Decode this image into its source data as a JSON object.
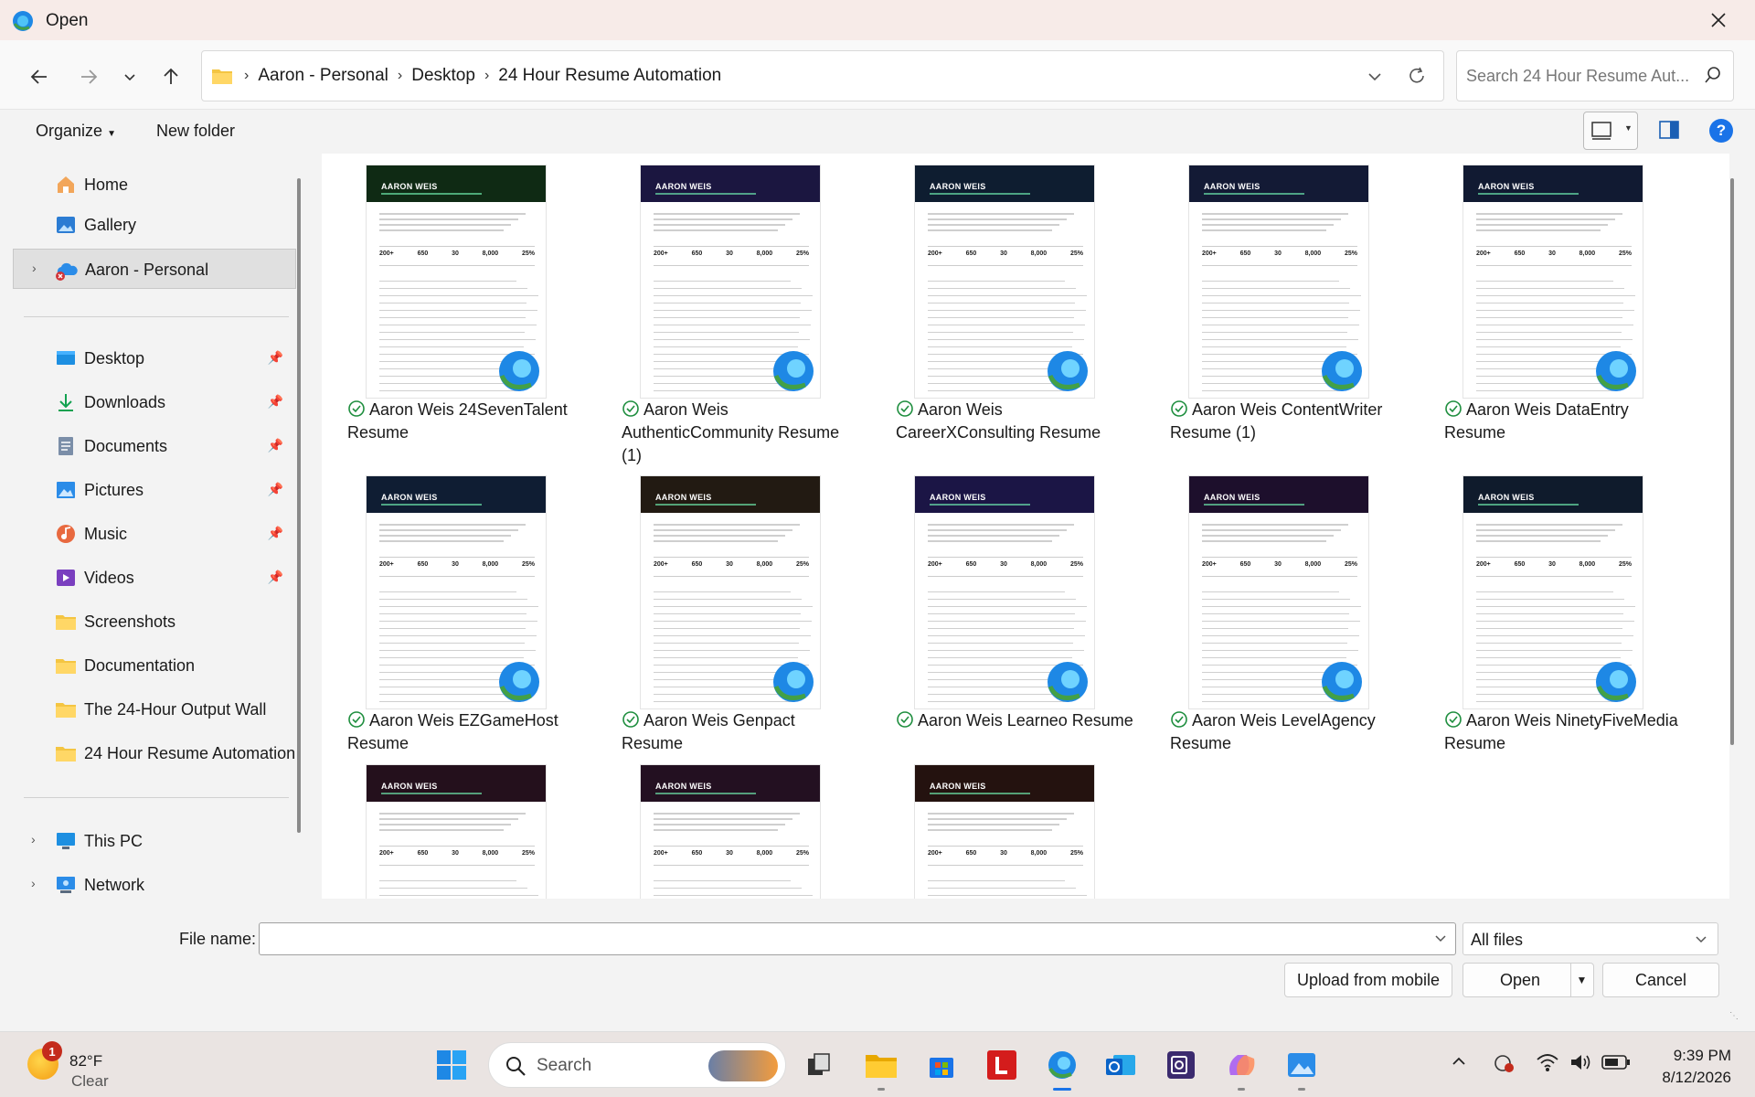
{
  "window": {
    "title": "Open"
  },
  "address": {
    "crumbs": [
      "Aaron - Personal",
      "Desktop",
      "24 Hour Resume Automation"
    ],
    "search_placeholder": "Search 24 Hour Resume Aut..."
  },
  "commands": {
    "organize": "Organize",
    "new_folder": "New folder"
  },
  "nav": {
    "home": "Home",
    "gallery": "Gallery",
    "onedrive": "Aaron - Personal",
    "desktop": "Desktop",
    "downloads": "Downloads",
    "documents": "Documents",
    "pictures": "Pictures",
    "music": "Music",
    "videos": "Videos",
    "screenshots": "Screenshots",
    "documentation": "Documentation",
    "output_wall": "The 24-Hour Output Wall",
    "resume_automation": "24 Hour Resume Automation",
    "this_pc": "This PC",
    "network": "Network"
  },
  "files": [
    {
      "name": "Aaron Weis 24SevenTalent Resume",
      "color": "#0f2a14"
    },
    {
      "name": "Aaron Weis AuthenticCommunity Resume (1)",
      "color": "#1b1640"
    },
    {
      "name": "Aaron Weis CareerXConsulting Resume",
      "color": "#0e1d30"
    },
    {
      "name": "Aaron Weis ContentWriter Resume (1)",
      "color": "#131a35"
    },
    {
      "name": "Aaron Weis DataEntry Resume",
      "color": "#111a32"
    },
    {
      "name": "Aaron Weis EZGameHost Resume",
      "color": "#0f1d33"
    },
    {
      "name": "Aaron Weis Genpact Resume",
      "color": "#221a12"
    },
    {
      "name": "Aaron Weis Learneo Resume",
      "color": "#1b1545"
    },
    {
      "name": "Aaron Weis LevelAgency Resume",
      "color": "#1d0f2c"
    },
    {
      "name": "Aaron Weis NinetyFiveMedia Resume",
      "color": "#0f1b2c"
    },
    {
      "name": "",
      "color": "#24101c"
    },
    {
      "name": "",
      "color": "#231021"
    },
    {
      "name": "",
      "color": "#24120f"
    }
  ],
  "thumb": {
    "owner": "AARON WEIS",
    "stats": [
      "200+",
      "650",
      "30",
      "8,000",
      "25%"
    ]
  },
  "bottom": {
    "file_name_label": "File name:",
    "file_name_value": "",
    "file_type": "All files",
    "upload": "Upload from mobile",
    "open": "Open",
    "cancel": "Cancel"
  },
  "taskbar": {
    "weather_badge": "1",
    "temperature": "82°F",
    "condition": "Clear",
    "search": "Search",
    "time": "9:39 PM",
    "date": "8/12/2026"
  }
}
